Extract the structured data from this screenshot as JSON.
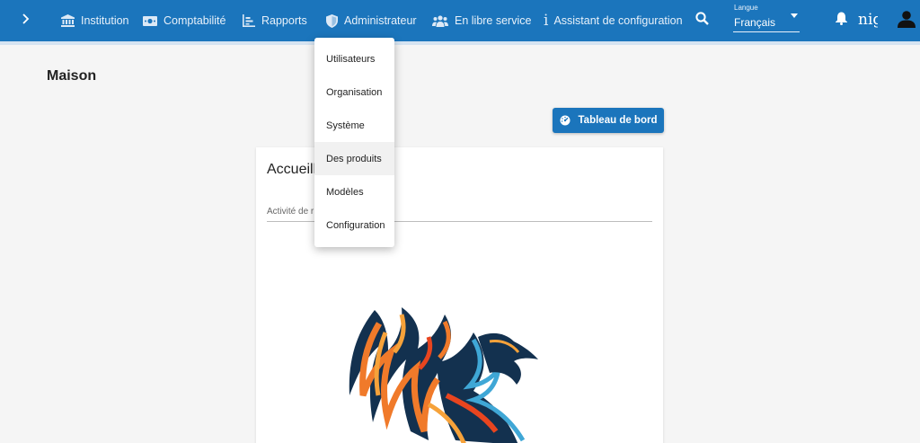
{
  "nav": {
    "items": [
      {
        "label": "Institution",
        "icon": "bank-icon"
      },
      {
        "label": "Comptabilité",
        "icon": "money-icon"
      },
      {
        "label": "Rapports",
        "icon": "chart-icon"
      },
      {
        "label": "Administrateur",
        "icon": "shield-icon"
      },
      {
        "label": "En libre service",
        "icon": "group-icon"
      },
      {
        "label": "Assistant de configuration",
        "icon": "info-icon"
      }
    ],
    "language": {
      "label": "Langue",
      "value": "Français"
    },
    "username": "nig"
  },
  "colors": {
    "primary": "#1b75bc",
    "background": "#f5f5f5",
    "menu_hover": "#f1f1f1"
  },
  "page": {
    "title": "Maison",
    "dashboard_button": "Tableau de bord",
    "card_title": "Accueill",
    "card_field": "Activité de r"
  },
  "admin_menu": {
    "items": [
      "Utilisateurs",
      "Organisation",
      "Système",
      "Des produits",
      "Modèles",
      "Configuration"
    ],
    "hovered": "Des produits"
  }
}
